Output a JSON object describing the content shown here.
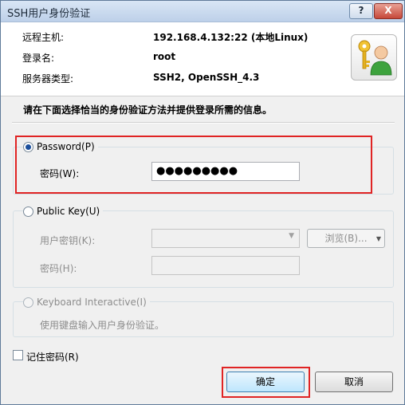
{
  "window": {
    "title": "SSH用户身份验证",
    "help_label": "?",
    "close_label": "X"
  },
  "info": {
    "host_label": "远程主机:",
    "host_value": "192.168.4.132:22 (本地Linux)",
    "login_label": "登录名:",
    "login_value": "root",
    "server_type_label": "服务器类型:",
    "server_type_value": "SSH2, OpenSSH_4.3"
  },
  "instruction": "请在下面选择恰当的身份验证方法并提供登录所需的信息。",
  "password_group": {
    "label": "Password(P)",
    "selected": true,
    "field_label": "密码(W):",
    "value": "●●●●●●●●●"
  },
  "publickey_group": {
    "label": "Public Key(U)",
    "selected": false,
    "key_label": "用户密钥(K):",
    "key_value": "",
    "browse_label": "浏览(B)...",
    "passphrase_label": "密码(H):",
    "passphrase_value": ""
  },
  "keyboard_group": {
    "label": "Keyboard Interactive(I)",
    "selected": false,
    "description": "使用键盘输入用户身份验证。"
  },
  "remember": {
    "label": "记住密码(R)",
    "checked": false
  },
  "buttons": {
    "ok": "确定",
    "cancel": "取消"
  },
  "colors": {
    "highlight": "#e02424",
    "radio_selected": "#1c4f9c"
  }
}
